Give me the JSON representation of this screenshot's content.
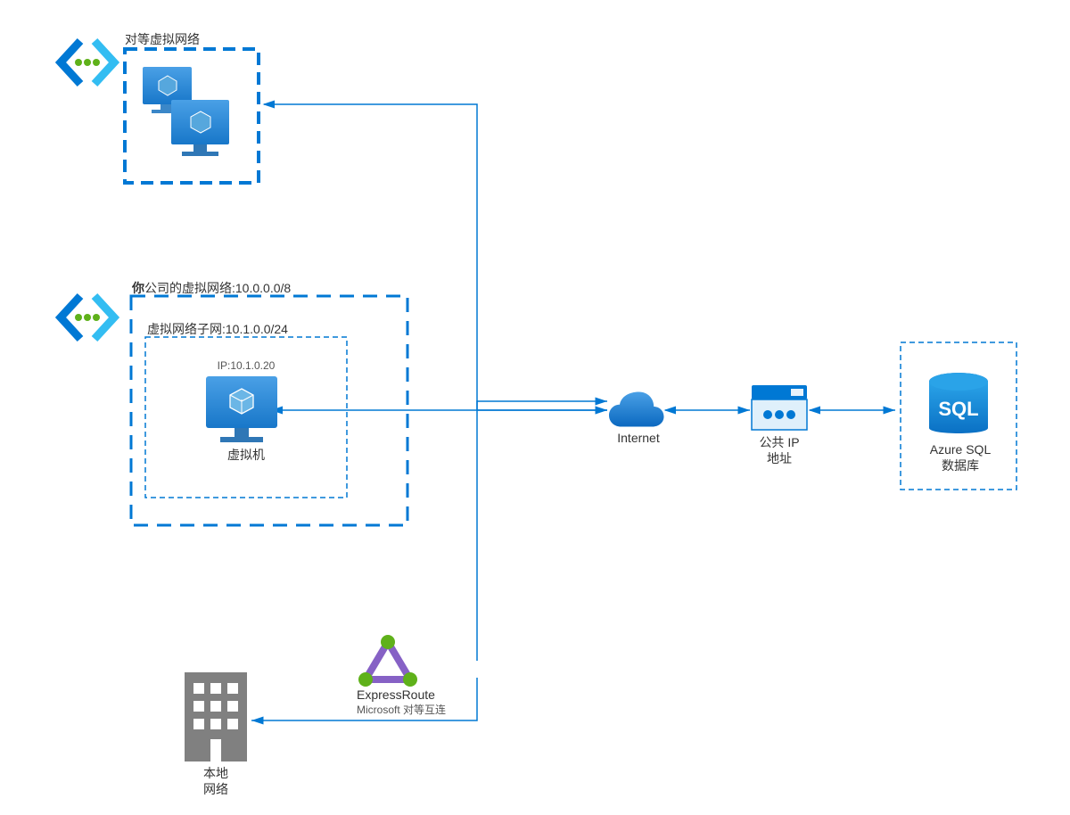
{
  "peered_vnet": {
    "title": "对等虚拟网络"
  },
  "company_vnet": {
    "title_prefix": "你",
    "title_rest": "公司的虚拟网络:10.0.0.0/8",
    "subnet_label": "虚拟网络子网:10.1.0.0/24",
    "vm_ip": "IP:10.1.0.20",
    "vm_label": "虚拟机"
  },
  "internet": {
    "label": "Internet"
  },
  "public_ip": {
    "line1": "公共 IP",
    "line2": "地址"
  },
  "sql": {
    "line1": "Azure SQL",
    "line2": "数据库"
  },
  "expressroute": {
    "title": "ExpressRoute",
    "subtitle": "Microsoft 对等互连"
  },
  "onprem": {
    "line1": "本地",
    "line2": "网络"
  },
  "colors": {
    "azure_blue": "#0078d4",
    "dark_blue": "#005ba1",
    "green": "#5fb11a",
    "purple": "#8661c5",
    "gray": "#808080"
  }
}
